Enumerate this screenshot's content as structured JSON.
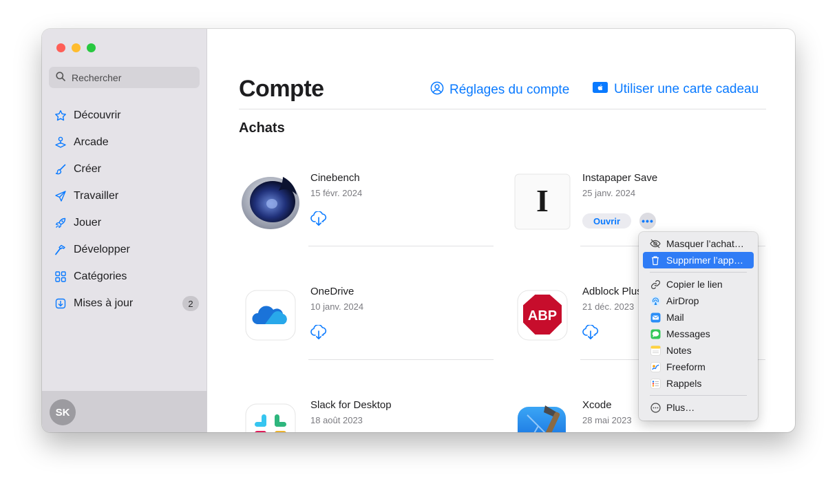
{
  "sidebar": {
    "search_placeholder": "Rechercher",
    "items": [
      {
        "label": "Découvrir",
        "icon": "star-icon"
      },
      {
        "label": "Arcade",
        "icon": "joystick-icon"
      },
      {
        "label": "Créer",
        "icon": "brush-icon"
      },
      {
        "label": "Travailler",
        "icon": "paperplane-icon"
      },
      {
        "label": "Jouer",
        "icon": "rocket-icon"
      },
      {
        "label": "Développer",
        "icon": "hammer-icon"
      },
      {
        "label": "Catégories",
        "icon": "grid-icon"
      },
      {
        "label": "Mises à jour",
        "icon": "download-square-icon",
        "badge": "2"
      }
    ],
    "avatar_initials": "SK"
  },
  "header": {
    "title": "Compte",
    "account_settings": "Réglages du compte",
    "gift_card": "Utiliser une carte cadeau"
  },
  "section_title": "Achats",
  "apps": [
    {
      "name": "Cinebench",
      "date": "15 févr. 2024",
      "icon": "cinebench-icon"
    },
    {
      "name": "Instapaper Save",
      "date": "25 janv. 2024",
      "icon": "instapaper-icon",
      "open_label": "Ouvrir"
    },
    {
      "name": "OneDrive",
      "date": "10 janv. 2024",
      "icon": "onedrive-icon"
    },
    {
      "name": "Adblock Plus",
      "date": "21 déc. 2023",
      "icon": "adblock-icon"
    },
    {
      "name": "Slack for Desktop",
      "date": "18 août 2023",
      "icon": "slack-icon"
    },
    {
      "name": "Xcode",
      "date": "28 mai 2023",
      "icon": "xcode-icon"
    }
  ],
  "context_menu": {
    "hide": "Masquer l’achat…",
    "delete": "Supprimer l’app…",
    "copy_link": "Copier le lien",
    "airdrop": "AirDrop",
    "mail": "Mail",
    "messages": "Messages",
    "notes": "Notes",
    "freeform": "Freeform",
    "reminders": "Rappels",
    "more": "Plus…"
  },
  "colors": {
    "accent": "#0a7aff",
    "sidebar_bg": "#e5e3e8",
    "menu_highlight": "#2f7cf6"
  }
}
